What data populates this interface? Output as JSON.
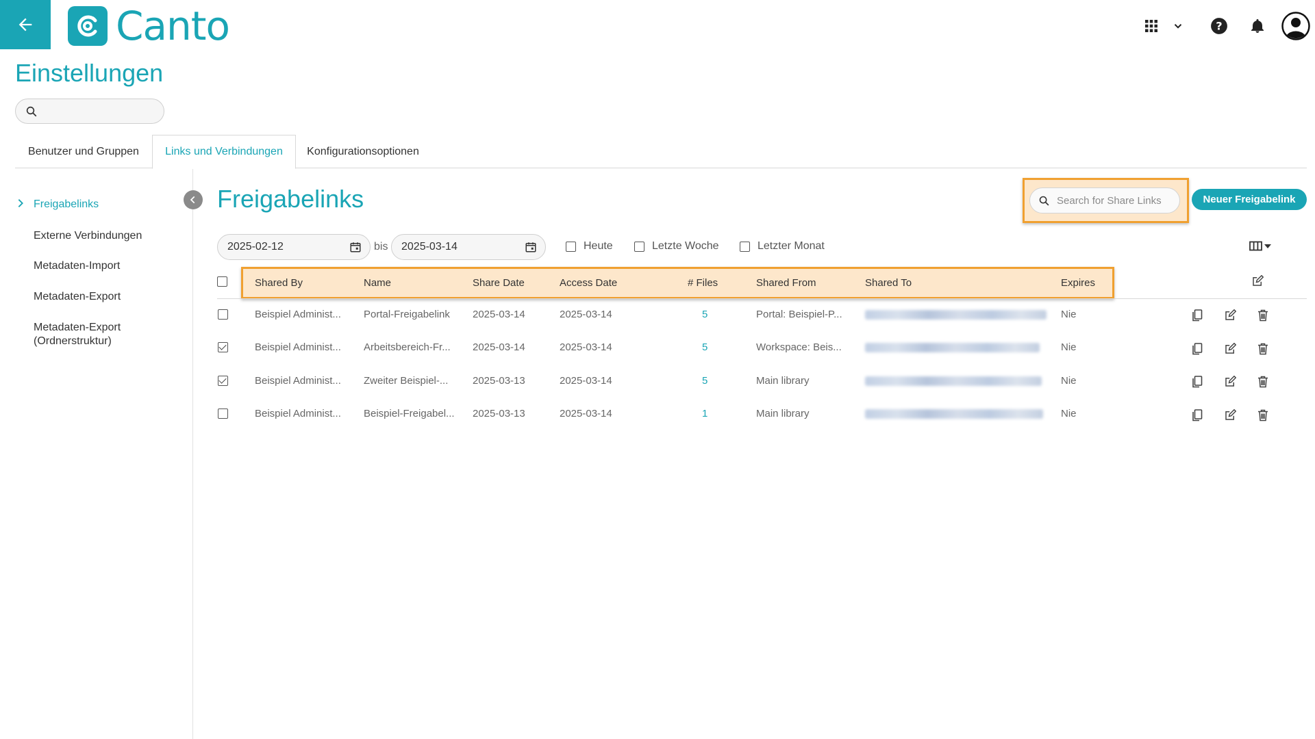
{
  "app": {
    "brand": "Canto",
    "page_title": "Einstellungen",
    "search_placeholder": ""
  },
  "colors": {
    "accent": "#1aa5b5",
    "highlight_border": "#f0a030",
    "highlight_fill": "#fcd4a0"
  },
  "tabs": [
    {
      "label": "Benutzer und Gruppen",
      "active": false
    },
    {
      "label": "Links und Verbindungen",
      "active": true
    },
    {
      "label": "Konfigurationsoptionen",
      "active": false
    }
  ],
  "sidebar": {
    "items": [
      {
        "label": "Freigabelinks",
        "active": true
      },
      {
        "label": "Externe Verbindungen",
        "active": false
      },
      {
        "label": "Metadaten-Import",
        "active": false
      },
      {
        "label": "Metadaten-Export",
        "active": false
      },
      {
        "label": "Metadaten-Export",
        "label2": "(Ordnerstruktur)",
        "active": false
      }
    ]
  },
  "main": {
    "title": "Freigabelinks",
    "share_search_placeholder": "Search for Share Links",
    "new_button": "Neuer Freigabelink",
    "date_from": "2025-02-12",
    "date_to": "2025-03-14",
    "bis": "bis",
    "filters": [
      {
        "label": "Heute",
        "checked": false
      },
      {
        "label": "Letzte Woche",
        "checked": false
      },
      {
        "label": "Letzter Monat",
        "checked": false
      }
    ]
  },
  "table": {
    "columns": [
      "Shared By",
      "Name",
      "Share Date",
      "Access Date",
      "# Files",
      "Shared From",
      "Shared To",
      "Expires"
    ],
    "rows": [
      {
        "checked": false,
        "shared_by": "Beispiel Administ...",
        "name": "Portal-Freigabelink",
        "share_date": "2025-03-14",
        "access_date": "2025-03-14",
        "files": "5",
        "shared_from": "Portal: Beispiel-P...",
        "expires": "Nie"
      },
      {
        "checked": true,
        "shared_by": "Beispiel Administ...",
        "name": "Arbeitsbereich-Fr...",
        "share_date": "2025-03-14",
        "access_date": "2025-03-14",
        "files": "5",
        "shared_from": "Workspace: Beis...",
        "expires": "Nie"
      },
      {
        "checked": true,
        "shared_by": "Beispiel Administ...",
        "name": "Zweiter Beispiel-...",
        "share_date": "2025-03-13",
        "access_date": "2025-03-14",
        "files": "5",
        "shared_from": "Main library",
        "expires": "Nie"
      },
      {
        "checked": false,
        "shared_by": "Beispiel Administ...",
        "name": "Beispiel-Freigabel...",
        "share_date": "2025-03-13",
        "access_date": "2025-03-14",
        "files": "1",
        "shared_from": "Main library",
        "expires": "Nie"
      }
    ]
  },
  "icons": {
    "back": "arrow-left-icon",
    "apps": "grid-icon",
    "dropdown": "chevron-down-icon",
    "help": "help-icon",
    "notifications": "bell-icon",
    "account": "user-avatar-icon",
    "search": "search-icon",
    "calendar": "calendar-icon",
    "columns": "columns-icon",
    "copy": "copy-icon",
    "edit": "edit-icon",
    "delete": "trash-icon"
  }
}
